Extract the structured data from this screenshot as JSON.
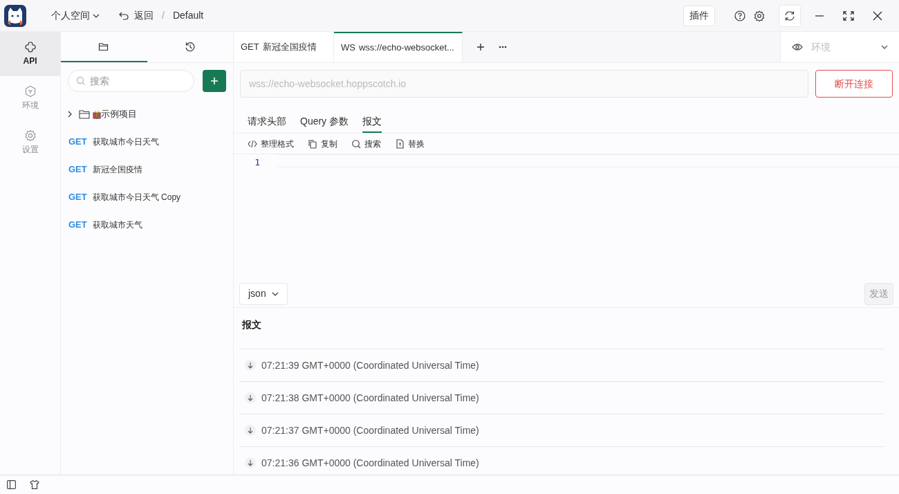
{
  "header": {
    "workspace": "个人空间",
    "back": "返回",
    "separator": "/",
    "project": "Default",
    "plugin_button": "插件"
  },
  "rail": [
    {
      "kind": "api",
      "label": "API",
      "selected": true
    },
    {
      "kind": "env",
      "label": "环境",
      "selected": false
    },
    {
      "kind": "settings",
      "label": "设置",
      "selected": false
    }
  ],
  "sidebar": {
    "tabs": [
      {
        "kind": "folder",
        "selected": true
      },
      {
        "kind": "history",
        "selected": false
      }
    ],
    "search": {
      "placeholder": "搜索"
    },
    "tree": [
      {
        "kind": "folder",
        "label": "示例项目",
        "expanded": false
      },
      {
        "kind": "request",
        "method": "GET",
        "label": "获取城市今日天气"
      },
      {
        "kind": "request",
        "method": "GET",
        "label": "新冠全国疫情"
      },
      {
        "kind": "request",
        "method": "GET",
        "label": "获取城市今日天气 Copy"
      },
      {
        "kind": "request",
        "method": "GET",
        "label": "获取城市天气"
      }
    ]
  },
  "request_tabs": [
    {
      "method": "GET",
      "label": "新冠全国疫情",
      "selected": false
    },
    {
      "method": "WS",
      "label": "wss://echo-websocket...",
      "selected": true
    }
  ],
  "environment": {
    "placeholder": "环境"
  },
  "url": {
    "value": "wss://echo-websocket.hoppscotch.io",
    "disabled": true
  },
  "connect_button": "断开连接",
  "body_tabs": [
    {
      "label": "请求头部",
      "selected": false
    },
    {
      "label": "Query 参数",
      "selected": false
    },
    {
      "label": "报文",
      "selected": true
    }
  ],
  "editor_toolbar": [
    {
      "kind": "format",
      "label": "整理格式"
    },
    {
      "kind": "copy",
      "label": "复制"
    },
    {
      "kind": "search",
      "label": "搜索"
    },
    {
      "kind": "replace",
      "label": "替换"
    }
  ],
  "editor": {
    "line_numbers": [
      "1"
    ]
  },
  "format_select": "json",
  "send_button": {
    "label": "发送",
    "disabled": true
  },
  "log": {
    "title": "报文",
    "entries": [
      {
        "kind": "received",
        "time": "07:21:39 GMT+0000 (Coordinated Universal Time)"
      },
      {
        "kind": "received",
        "time": "07:21:38 GMT+0000 (Coordinated Universal Time)"
      },
      {
        "kind": "received",
        "time": "07:21:37 GMT+0000 (Coordinated Universal Time)"
      },
      {
        "kind": "received",
        "time": "07:21:36 GMT+0000 (Coordinated Universal Time)"
      }
    ]
  }
}
